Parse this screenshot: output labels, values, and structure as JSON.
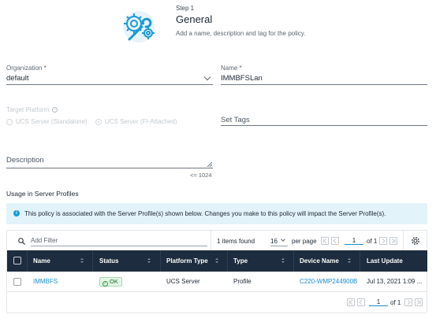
{
  "step": {
    "number": "Step 1",
    "title": "General",
    "description": "Add a name, description and tag for the policy.",
    "icon": "gears-wrench-icon"
  },
  "form": {
    "organization_label": "Organization *",
    "organization_value": "default",
    "name_label": "Name *",
    "name_value": "IMMBFSLan",
    "target_platform_label": "Target Platform",
    "platform_options": [
      "UCS Server (Standalone)",
      "UCS Server (FI-Attached)"
    ],
    "set_tags_placeholder": "Set Tags",
    "description_placeholder": "Description",
    "char_limit": "<= 1024"
  },
  "usage": {
    "section_title": "Usage in Server Profiles",
    "banner_text": "This policy is associated with the Server Profile(s) shown below. Changes you make to this policy will impact the Server Profile(s)."
  },
  "table": {
    "filter_placeholder": "Add Filter",
    "items_found": "1 items found",
    "per_page_value": "16",
    "per_page_label": "per page",
    "page_current": "1",
    "page_of": "of 1",
    "columns": [
      "Name",
      "Status",
      "Platform Type",
      "Type",
      "Device Name",
      "Last Update"
    ],
    "rows": [
      {
        "name": "IMMBFS",
        "status": "OK",
        "platform_type": "UCS Server",
        "type": "Profile",
        "device_name": "C220-WMP244900B",
        "last_update": "Jul 13, 2021 1:09 ..."
      }
    ],
    "footer_page_current": "1",
    "footer_page_of": "of 1"
  },
  "colors": {
    "accent": "#1a8ccf",
    "header_bg": "#1d2c3e",
    "banner_bg": "#e3f3fa",
    "ok_bg": "#e4f5e6"
  }
}
